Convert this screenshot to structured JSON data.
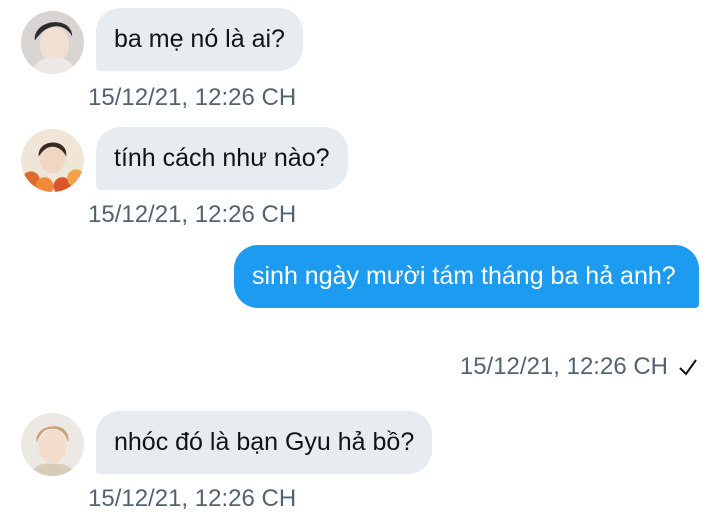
{
  "messages": [
    {
      "direction": "incoming",
      "avatar": "avatar-boy-dark-hair",
      "text": "ba mẹ nó là ai?",
      "timestamp": "15/12/21, 12:26 CH"
    },
    {
      "direction": "incoming",
      "avatar": "avatar-boy-flowers",
      "text": "tính cách như nào?",
      "timestamp": "15/12/21, 12:26 CH"
    },
    {
      "direction": "outgoing",
      "text": "sinh ngày mười tám tháng ba hả anh?",
      "timestamp": "15/12/21, 12:26 CH",
      "status_icon": "check-icon"
    },
    {
      "direction": "incoming",
      "avatar": "avatar-boy-light-hair",
      "text": "nhóc đó là bạn Gyu hả bồ?",
      "timestamp": "15/12/21, 12:26 CH"
    }
  ],
  "colors": {
    "incoming_bubble": "#e7ecf0",
    "outgoing_bubble": "#1d9bf0",
    "timestamp_text": "#536471"
  }
}
